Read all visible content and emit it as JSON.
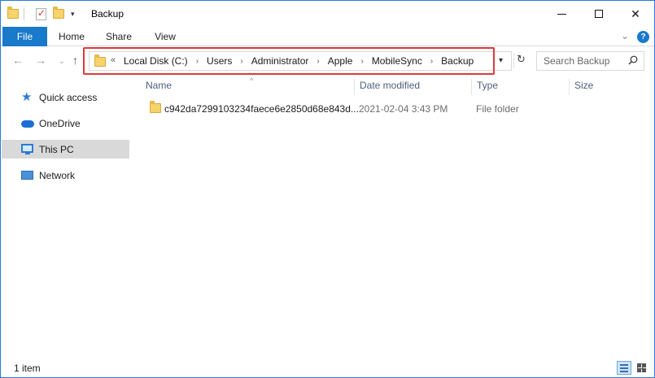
{
  "window": {
    "title": "Backup",
    "minimize_glyph": "",
    "close_glyph": "✕"
  },
  "ribbon": {
    "tabs": [
      {
        "label": "File"
      },
      {
        "label": "Home"
      },
      {
        "label": "Share"
      },
      {
        "label": "View"
      }
    ],
    "help_glyph": "?"
  },
  "navigation": {
    "back_glyph": "←",
    "forward_glyph": "→",
    "recent_glyph": "⌄",
    "up_glyph": "↑",
    "overflow_glyph": "«",
    "breadcrumbs": [
      "Local Disk (C:)",
      "Users",
      "Administrator",
      "Apple",
      "MobileSync",
      "Backup"
    ],
    "separator_glyph": "›",
    "refresh_glyph": "↻"
  },
  "search": {
    "placeholder": "Search Backup"
  },
  "sidebar": {
    "items": [
      {
        "label": "Quick access",
        "icon": "star-icon"
      },
      {
        "label": "OneDrive",
        "icon": "cloud-icon"
      },
      {
        "label": "This PC",
        "icon": "computer-icon",
        "selected": true
      },
      {
        "label": "Network",
        "icon": "network-icon"
      }
    ]
  },
  "columns": {
    "name": "Name",
    "date": "Date modified",
    "type": "Type",
    "size": "Size"
  },
  "files": [
    {
      "name": "c942da7299103234faece6e2850d68e843d...",
      "date": "2021-02-04 3:43 PM",
      "type": "File folder",
      "size": ""
    }
  ],
  "status": {
    "item_count": "1 item"
  },
  "colors": {
    "accent": "#1979ca",
    "highlight_border": "#e0383a",
    "selected_bg": "#d9d9d9"
  }
}
